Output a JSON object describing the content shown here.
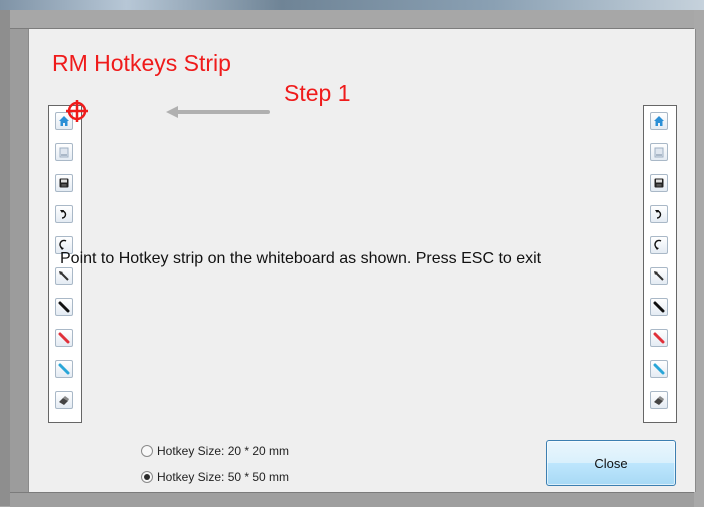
{
  "dialog": {
    "title_text": "RM Hotkeys Strip",
    "step_text": "Step 1",
    "instruction": "Point to Hotkey strip on the whiteboard as shown. Press ESC to exit"
  },
  "hotkeys": [
    {
      "icon": "home-icon"
    },
    {
      "icon": "new-page-icon"
    },
    {
      "icon": "save-icon"
    },
    {
      "icon": "undo-icon"
    },
    {
      "icon": "redo-icon"
    },
    {
      "icon": "pointer-pen-icon"
    },
    {
      "icon": "black-pen-icon"
    },
    {
      "icon": "red-pen-icon"
    },
    {
      "icon": "blue-pen-icon"
    },
    {
      "icon": "eraser-icon"
    }
  ],
  "options": {
    "size_small_label": "Hotkey Size: 20 * 20 mm",
    "size_large_label": "Hotkey Size: 50 * 50 mm",
    "selected": "size_large"
  },
  "buttons": {
    "close_label": "Close"
  },
  "colors": {
    "accent_red": "#ef1b1b",
    "button_border": "#3c7fb1",
    "icon_blue": "#2b8fd6"
  }
}
